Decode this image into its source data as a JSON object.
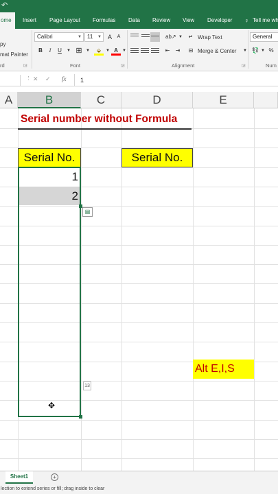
{
  "ribbon_tabs": {
    "home": "ome",
    "insert": "Insert",
    "page_layout": "Page Layout",
    "formulas": "Formulas",
    "data": "Data",
    "review": "Review",
    "view": "View",
    "developer": "Developer",
    "tell_me": "Tell me wh"
  },
  "clipboard": {
    "copy": "py",
    "format_painter": "mat Painter",
    "label": "rd"
  },
  "font": {
    "name": "Calibri",
    "size": "11",
    "grow": "A",
    "shrink": "A",
    "bold": "B",
    "italic": "I",
    "underline": "U",
    "label": "Font"
  },
  "alignment": {
    "wrap_text": "Wrap Text",
    "merge_center": "Merge & Center",
    "label": "Alignment"
  },
  "number": {
    "format": "General",
    "percent": "%",
    "label": "Num"
  },
  "formula_bar": {
    "fx": "fx",
    "value": "1"
  },
  "columns": [
    "A",
    "B",
    "C",
    "D",
    "E"
  ],
  "sheet": {
    "title": "Serial number without Formula",
    "header_b": "Serial No.",
    "header_d": "Serial No.",
    "b_values": [
      "1",
      "2"
    ],
    "fill_count": "13",
    "note": "Alt E,I,S"
  },
  "sheet_tabs": {
    "active": "Sheet1",
    "add": "+"
  },
  "status_bar": "lection to extend series or fill; drag inside to clear",
  "colors": {
    "excel_green": "#217346",
    "title_red": "#c00000",
    "highlight_yellow": "#ffff00"
  },
  "icons": [
    "undo-icon",
    "cut-icon",
    "copy-icon",
    "format-painter-icon",
    "fill-color-icon",
    "font-color-icon",
    "borders-icon",
    "align-left-icon",
    "align-center-icon",
    "align-right-icon",
    "wrap-text-icon",
    "merge-icon",
    "cancel-icon",
    "enter-icon",
    "quick-analysis-icon",
    "cell-cursor-icon",
    "add-sheet-icon",
    "lightbulb-icon"
  ]
}
